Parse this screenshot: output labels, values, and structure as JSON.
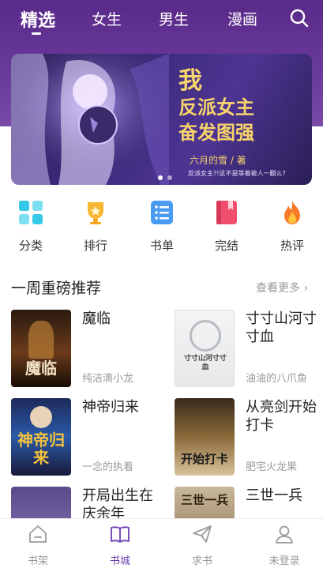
{
  "header": {
    "tabs": [
      {
        "label": "精选"
      },
      {
        "label": "女生"
      },
      {
        "label": "男生"
      },
      {
        "label": "漫画"
      }
    ]
  },
  "banner": {
    "title_line1": "我",
    "title_line2": "反派女主",
    "title_line3": "奋发图强",
    "author": "六月的雪 / 著",
    "subtitle": "反派女主?!这不是等着被人一翻么?"
  },
  "categories": [
    {
      "label": "分类",
      "icon": "grid-icon"
    },
    {
      "label": "排行",
      "icon": "trophy-icon"
    },
    {
      "label": "书单",
      "icon": "list-icon"
    },
    {
      "label": "完结",
      "icon": "bookmark-icon"
    },
    {
      "label": "热评",
      "icon": "flame-icon"
    }
  ],
  "section": {
    "title": "一周重磅推荐",
    "more": "查看更多 ›"
  },
  "books": [
    {
      "title": "魔临",
      "author": "纯洁滴小龙",
      "cover_text": "魔临"
    },
    {
      "title": "寸寸山河寸寸血",
      "author": "油油的八爪鱼",
      "cover_text": "寸寸山河寸寸血"
    },
    {
      "title": "神帝归来",
      "author": "一念的执着",
      "cover_text": "神帝归来"
    },
    {
      "title": "从亮剑开始打卡",
      "author": "肥宅火龙果",
      "cover_text": "开始打卡"
    },
    {
      "title": "开局出生在庆余年",
      "author": "",
      "cover_text": ""
    },
    {
      "title": "三世一兵",
      "author": "",
      "cover_text": "三世一兵"
    }
  ],
  "bottom_nav": [
    {
      "label": "书架",
      "icon": "home-icon"
    },
    {
      "label": "书城",
      "icon": "book-open-icon"
    },
    {
      "label": "求书",
      "icon": "paper-plane-icon"
    },
    {
      "label": "未登录",
      "icon": "user-icon"
    }
  ],
  "colors": {
    "header_bg": "#5a2a8a",
    "accent": "#6a3fb0",
    "banner_title": "#f6d36b"
  }
}
